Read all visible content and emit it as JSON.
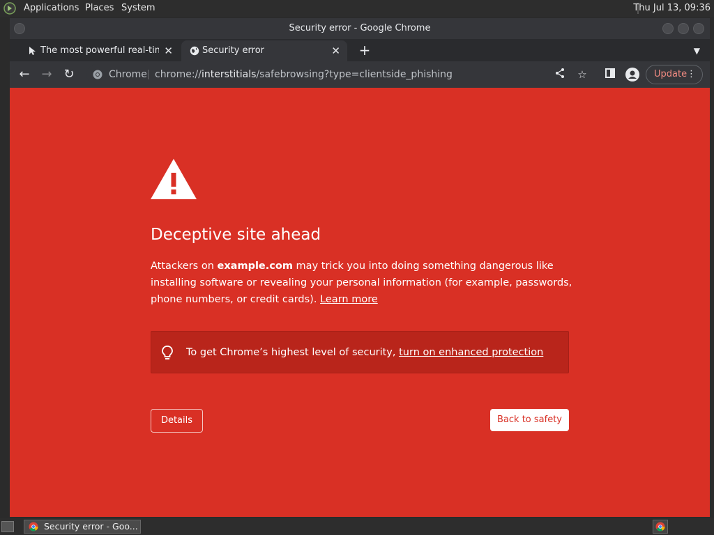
{
  "top_panel": {
    "menus": [
      "Applications",
      "Places",
      "System"
    ],
    "clock": "Thu Jul 13, 09:36"
  },
  "window": {
    "title": "Security error - Google Chrome"
  },
  "tabs": [
    {
      "title": "The most powerful real-time",
      "active": false
    },
    {
      "title": "Security error",
      "active": true
    }
  ],
  "toolbar": {
    "scheme_label": "Chrome",
    "url_prefix": "chrome://",
    "url_host": "interstitials",
    "url_path": "/safebrowsing?type=clientside_phishing",
    "update_label": "Update"
  },
  "interstitial": {
    "heading": "Deceptive site ahead",
    "body_1": "Attackers on ",
    "body_domain": "example.com",
    "body_2": " may trick you into doing something dangerous like installing software or revealing your personal information (for example, passwords, phone numbers, or credit cards). ",
    "learn_more": "Learn more",
    "enhanced_text": "To get Chrome’s highest level of security, ",
    "enhanced_link": "turn on enhanced protection",
    "details_label": "Details",
    "back_label": "Back to safety"
  },
  "taskbar": {
    "task_label": "Security error - Goo..."
  },
  "colors": {
    "interstitial_bg": "#d93025",
    "enhanced_box_bg": "#b9251b"
  }
}
